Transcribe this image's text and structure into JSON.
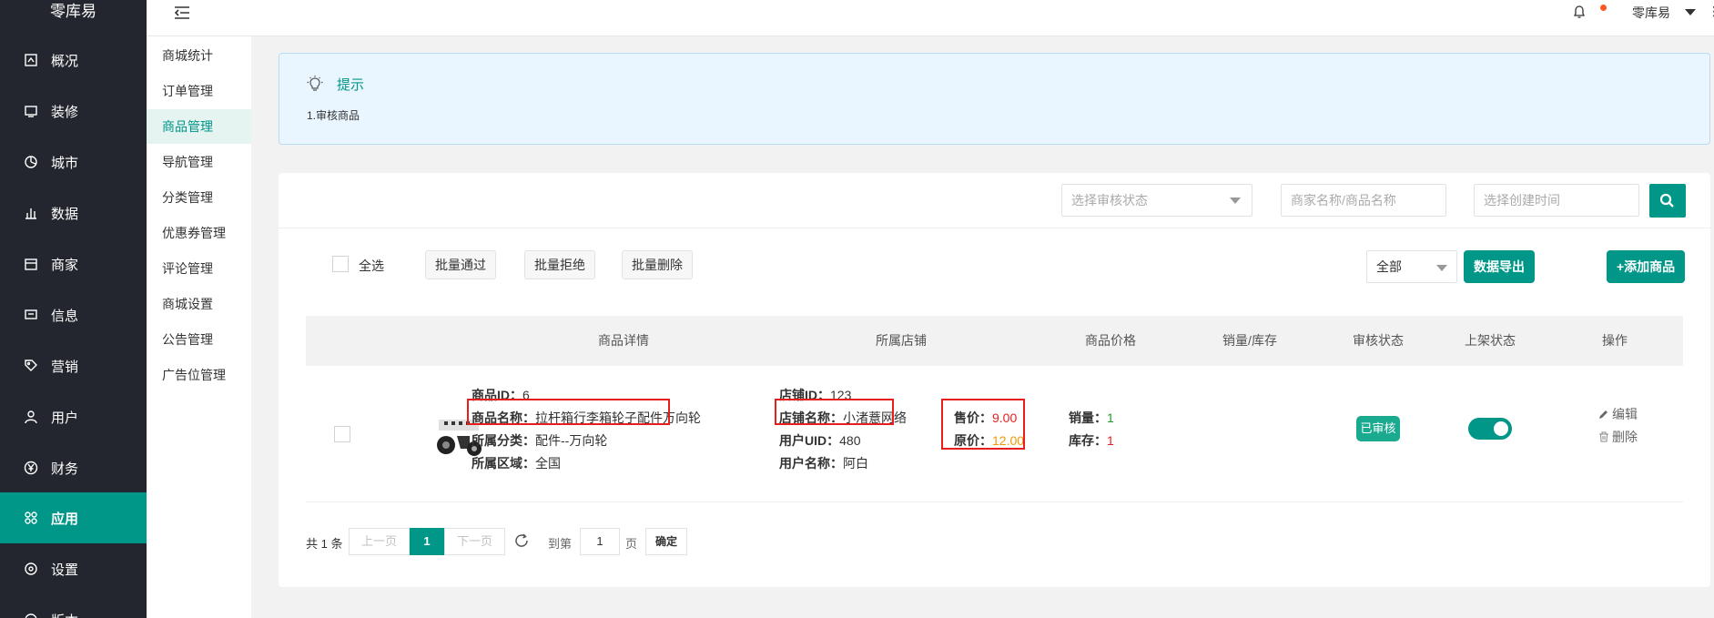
{
  "app": {
    "logo": "零库易"
  },
  "sidebar": {
    "items": [
      {
        "label": "概况",
        "icon": "overview-icon"
      },
      {
        "label": "装修",
        "icon": "decorate-icon"
      },
      {
        "label": "城市",
        "icon": "city-icon"
      },
      {
        "label": "数据",
        "icon": "data-chart-icon"
      },
      {
        "label": "商家",
        "icon": "merchant-icon"
      },
      {
        "label": "信息",
        "icon": "message-icon"
      },
      {
        "label": "营销",
        "icon": "tag-icon"
      },
      {
        "label": "用户",
        "icon": "user-icon"
      },
      {
        "label": "财务",
        "icon": "yen-icon"
      },
      {
        "label": "应用",
        "icon": "apps-icon",
        "active": true
      },
      {
        "label": "设置",
        "icon": "settings-icon"
      },
      {
        "label": "版本",
        "icon": "version-icon"
      }
    ]
  },
  "submenu": {
    "items": [
      "商城统计",
      "订单管理",
      "商品管理",
      "导航管理",
      "分类管理",
      "优惠券管理",
      "评论管理",
      "商城设置",
      "公告管理",
      "广告位管理"
    ],
    "active_index": 2
  },
  "header": {
    "user": "零库易"
  },
  "tip": {
    "title": "提示",
    "text": "1.审核商品"
  },
  "filters": {
    "audit_status_placeholder": "选择审核状态",
    "name_placeholder": "商家名称/商品名称",
    "time_placeholder": "选择创建时间"
  },
  "toolbar": {
    "select_all": "全选",
    "batch_pass": "批量通过",
    "batch_reject": "批量拒绝",
    "batch_delete": "批量删除",
    "scope_select": "全部",
    "export": "数据导出",
    "add_product": "+添加商品"
  },
  "table": {
    "columns": [
      "商品详情",
      "所属店铺",
      "商品价格",
      "销量/库存",
      "审核状态",
      "上架状态",
      "操作"
    ],
    "rows": [
      {
        "product_id_label": "商品ID：",
        "product_id": "6",
        "name_label": "商品名称：",
        "name": "拉杆箱行李箱轮子配件万向轮",
        "category_label": "所属分类：",
        "category": "配件--万向轮",
        "region_label": "所属区域：",
        "region": "全国",
        "shop_id_label": "店铺ID：",
        "shop_id": "123",
        "shop_name_label": "店铺名称：",
        "shop_name": "小渚薏网络",
        "uid_label": "用户UID：",
        "uid": "480",
        "user_name_label": "用户名称：",
        "user_name": "阿白",
        "sale_price_label": "售价：",
        "sale_price": "9.00",
        "original_price_label": "原价：",
        "original_price": "12.00",
        "sales_label": "销量：",
        "sales": "1",
        "stock_label": "库存：",
        "stock": "1",
        "audit_status": "已审核",
        "listed": true,
        "edit": "编辑",
        "delete": "删除"
      }
    ]
  },
  "pagination": {
    "total": "共 1 条",
    "prev": "上一页",
    "current": "1",
    "next": "下一页",
    "goto_label": "到第",
    "goto_value": "1",
    "page_label": "页",
    "confirm": "确定"
  },
  "colors": {
    "primary": "#009688",
    "sidebar_bg": "#23262e",
    "highlight_box": "#e61e1e",
    "price_red": "#e61e1e",
    "price_orange": "#f39800"
  }
}
